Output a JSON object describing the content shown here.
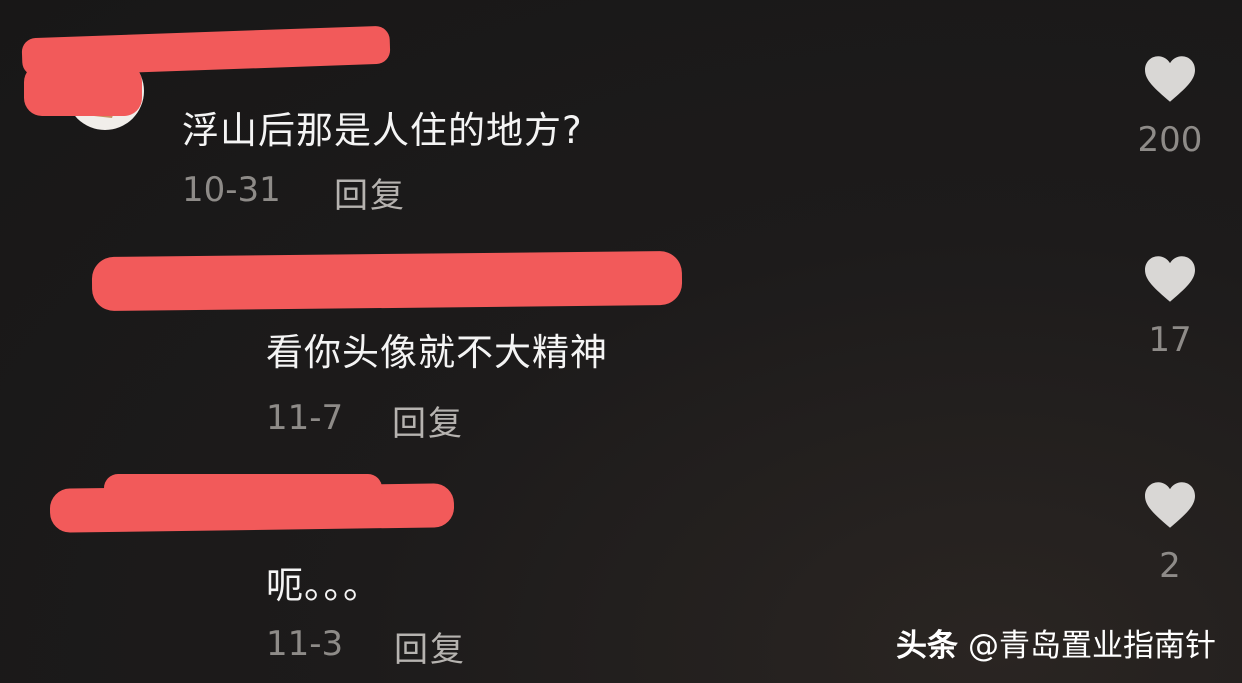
{
  "comments": [
    {
      "text": "浮山后那是人住的地方?",
      "date": "10-31",
      "reply_label": "回复",
      "likes": "200"
    },
    {
      "text": "看你头像就不大精神",
      "date": "11-7",
      "reply_label": "回复",
      "likes": "17"
    },
    {
      "text": "呃。。。",
      "date": "11-3",
      "reply_label": "回复",
      "likes": "2"
    }
  ],
  "watermark": {
    "brand": "头条",
    "handle": "@青岛置业指南针"
  },
  "colors": {
    "background": "#1c1a1a",
    "redaction": "#f25a5a",
    "muted_text": "#8e8b88",
    "heart": "#d9d7d5"
  },
  "icons": {
    "like": "heart-icon"
  }
}
